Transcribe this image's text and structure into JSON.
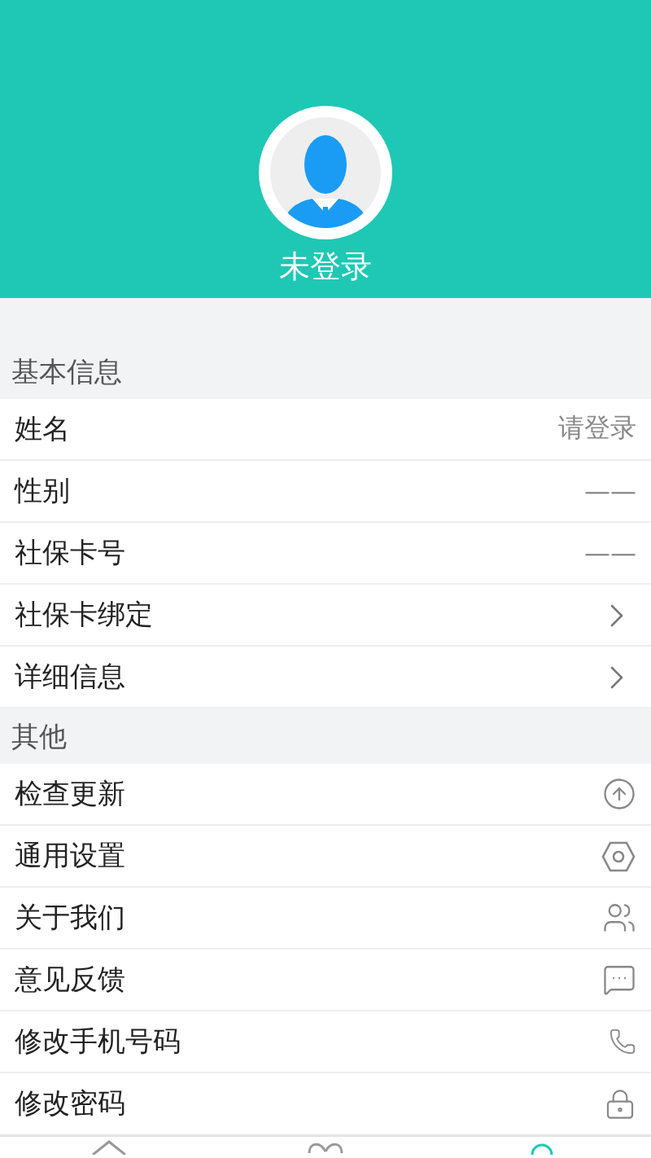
{
  "header": {
    "status": "未登录"
  },
  "sections": [
    {
      "title": "基本信息",
      "rows": [
        {
          "label": "姓名",
          "kind": "value",
          "value": "请登录"
        },
        {
          "label": "性别",
          "kind": "value",
          "value": "——"
        },
        {
          "label": "社保卡号",
          "kind": "value",
          "value": "——"
        },
        {
          "label": "社保卡绑定",
          "kind": "arrow"
        },
        {
          "label": "详细信息",
          "kind": "arrow"
        }
      ]
    },
    {
      "title": "其他",
      "rows": [
        {
          "label": "检查更新",
          "kind": "icon"
        },
        {
          "label": "通用设置",
          "kind": "icon"
        },
        {
          "label": "关于我们",
          "kind": "icon"
        },
        {
          "label": "意见反馈",
          "kind": "icon"
        },
        {
          "label": "修改手机号码",
          "kind": "icon"
        },
        {
          "label": "修改密码",
          "kind": "icon"
        }
      ]
    }
  ],
  "tabs": [
    {
      "selected": false
    },
    {
      "selected": false
    },
    {
      "selected": true
    }
  ]
}
